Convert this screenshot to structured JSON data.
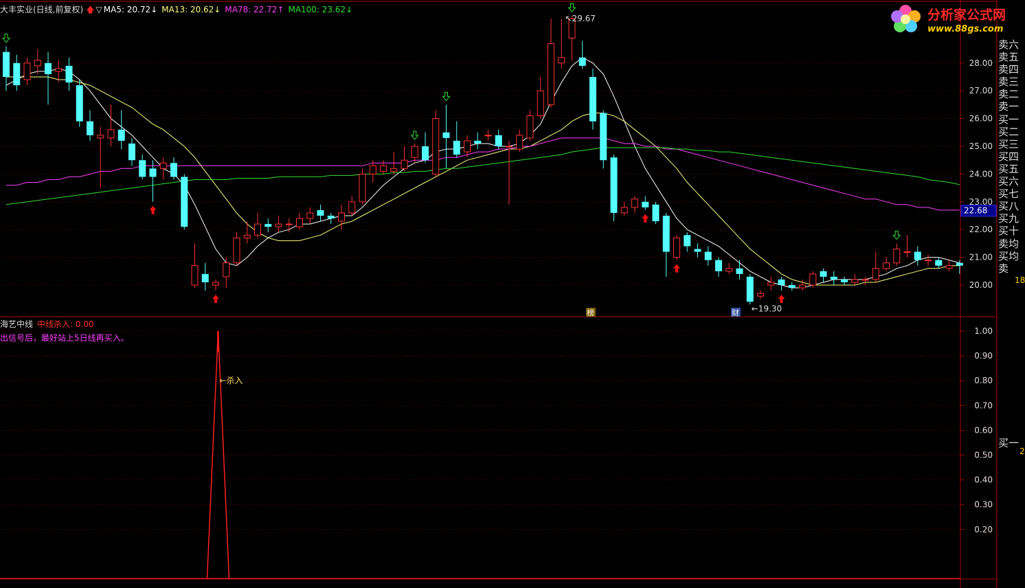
{
  "header": {
    "stock_title": "大丰实业(日线,前复权)",
    "arrow_glyph": "▽",
    "ma5": "MA5: 20.72",
    "ma13": "MA13: 20.62",
    "ma78": "MA78: 22.72",
    "ma100": "MA100: 23.62",
    "down_arrow": "↓",
    "up_arrow": "↑"
  },
  "logo": {
    "name": "分析家公式网",
    "url_text": "www.88gs.com"
  },
  "indicator": {
    "name": "海艺中线",
    "value_label": "中线杀入: 0.00",
    "note": "出信号后，最好站上5日线再买入。",
    "signal_label": "←杀入"
  },
  "order_book": [
    "卖六",
    "卖五",
    "卖四",
    "卖三",
    "卖二",
    "卖一",
    "买一",
    "买二",
    "买三",
    "买四",
    "买五",
    "买六",
    "买七",
    "买八",
    "买九",
    "买十",
    "卖均",
    "买均",
    "卖"
  ],
  "order_book_bottom": "买一",
  "side_numbers": {
    "upper": "18",
    "lower": "2"
  },
  "price_box": "22.68",
  "annotations": {
    "high": "29.67",
    "low": "←19.30",
    "bang": "榜",
    "cai": "财"
  },
  "colors": {
    "up": "#ff3232",
    "down": "#54ffff",
    "ma5": "#ffffff",
    "ma13": "#ffff80",
    "ma78": "#ff40ff",
    "ma100": "#30e030",
    "axis": "#b00000",
    "signal": "#ff2020"
  },
  "chart_data": [
    {
      "type": "candlestick",
      "title": "大丰实业(日线,前复权)",
      "ylim": [
        19.2,
        29.8
      ],
      "yticks": [
        20.0,
        21.0,
        22.0,
        23.0,
        24.0,
        25.0,
        26.0,
        27.0,
        28.0
      ],
      "candles": [
        {
          "o": 28.4,
          "c": 27.5,
          "h": 28.6,
          "l": 27.0
        },
        {
          "o": 28.0,
          "c": 27.2,
          "h": 28.3,
          "l": 27.0
        },
        {
          "o": 27.4,
          "c": 28.0,
          "h": 28.2,
          "l": 27.2
        },
        {
          "o": 27.9,
          "c": 28.1,
          "h": 28.5,
          "l": 27.6
        },
        {
          "o": 28.0,
          "c": 27.6,
          "h": 28.4,
          "l": 26.5
        },
        {
          "o": 27.7,
          "c": 27.8,
          "h": 28.1,
          "l": 27.3
        },
        {
          "o": 27.9,
          "c": 27.3,
          "h": 28.2,
          "l": 27.0
        },
        {
          "o": 27.2,
          "c": 25.9,
          "h": 27.4,
          "l": 25.7
        },
        {
          "o": 25.9,
          "c": 25.4,
          "h": 26.3,
          "l": 25.2
        },
        {
          "o": 25.3,
          "c": 25.4,
          "h": 25.7,
          "l": 23.5
        },
        {
          "o": 25.3,
          "c": 25.6,
          "h": 26.5,
          "l": 25.0
        },
        {
          "o": 25.6,
          "c": 25.2,
          "h": 26.3,
          "l": 24.9
        },
        {
          "o": 25.1,
          "c": 24.5,
          "h": 25.3,
          "l": 24.3
        },
        {
          "o": 24.5,
          "c": 23.9,
          "h": 24.7,
          "l": 23.8
        },
        {
          "o": 24.2,
          "c": 23.9,
          "h": 24.5,
          "l": 23.0
        },
        {
          "o": 24.2,
          "c": 24.4,
          "h": 24.6,
          "l": 23.8
        },
        {
          "o": 24.4,
          "c": 23.9,
          "h": 24.6,
          "l": 23.8
        },
        {
          "o": 23.9,
          "c": 22.1,
          "h": 24.0,
          "l": 22.0
        },
        {
          "o": 20.0,
          "c": 20.7,
          "h": 21.5,
          "l": 19.9
        },
        {
          "o": 20.4,
          "c": 20.1,
          "h": 20.8,
          "l": 19.8
        },
        {
          "o": 20.0,
          "c": 20.1,
          "h": 20.2,
          "l": 19.8
        },
        {
          "o": 20.3,
          "c": 20.8,
          "h": 21.0,
          "l": 19.9
        },
        {
          "o": 20.8,
          "c": 21.7,
          "h": 21.9,
          "l": 20.7
        },
        {
          "o": 21.7,
          "c": 21.8,
          "h": 22.3,
          "l": 21.5
        },
        {
          "o": 21.8,
          "c": 22.2,
          "h": 22.6,
          "l": 21.7
        },
        {
          "o": 22.2,
          "c": 22.1,
          "h": 22.4,
          "l": 21.9
        },
        {
          "o": 22.1,
          "c": 22.2,
          "h": 22.5,
          "l": 21.9
        },
        {
          "o": 22.2,
          "c": 22.2,
          "h": 22.4,
          "l": 21.9
        },
        {
          "o": 22.1,
          "c": 22.4,
          "h": 22.6,
          "l": 22.0
        },
        {
          "o": 22.4,
          "c": 22.6,
          "h": 22.8,
          "l": 22.2
        },
        {
          "o": 22.7,
          "c": 22.5,
          "h": 22.9,
          "l": 22.3
        },
        {
          "o": 22.5,
          "c": 22.4,
          "h": 22.6,
          "l": 22.2
        },
        {
          "o": 22.3,
          "c": 22.6,
          "h": 22.9,
          "l": 22.0
        },
        {
          "o": 22.6,
          "c": 23.0,
          "h": 23.2,
          "l": 22.5
        },
        {
          "o": 23.0,
          "c": 24.0,
          "h": 24.2,
          "l": 22.9
        },
        {
          "o": 24.0,
          "c": 24.3,
          "h": 24.5,
          "l": 23.7
        },
        {
          "o": 24.1,
          "c": 24.3,
          "h": 24.5,
          "l": 24.0
        },
        {
          "o": 24.1,
          "c": 24.2,
          "h": 24.8,
          "l": 24.0
        },
        {
          "o": 24.2,
          "c": 24.5,
          "h": 25.0,
          "l": 24.1
        },
        {
          "o": 24.6,
          "c": 25.0,
          "h": 25.1,
          "l": 24.4
        },
        {
          "o": 25.0,
          "c": 24.5,
          "h": 25.5,
          "l": 24.4
        },
        {
          "o": 24.0,
          "c": 26.0,
          "h": 26.3,
          "l": 23.9
        },
        {
          "o": 25.5,
          "c": 25.3,
          "h": 26.5,
          "l": 24.2
        },
        {
          "o": 25.2,
          "c": 24.7,
          "h": 25.9,
          "l": 24.6
        },
        {
          "o": 24.8,
          "c": 25.2,
          "h": 25.4,
          "l": 24.6
        },
        {
          "o": 25.2,
          "c": 25.1,
          "h": 25.5,
          "l": 24.9
        },
        {
          "o": 25.4,
          "c": 25.4,
          "h": 25.6,
          "l": 25.2
        },
        {
          "o": 25.4,
          "c": 25.0,
          "h": 25.6,
          "l": 24.9
        },
        {
          "o": 25.0,
          "c": 25.0,
          "h": 25.2,
          "l": 22.9
        },
        {
          "o": 24.9,
          "c": 25.4,
          "h": 25.6,
          "l": 24.8
        },
        {
          "o": 25.3,
          "c": 26.1,
          "h": 26.3,
          "l": 25.2
        },
        {
          "o": 26.1,
          "c": 27.0,
          "h": 27.5,
          "l": 26.0
        },
        {
          "o": 26.5,
          "c": 28.7,
          "h": 29.6,
          "l": 26.4
        },
        {
          "o": 28.0,
          "c": 28.2,
          "h": 29.6,
          "l": 27.8
        },
        {
          "o": 28.9,
          "c": 29.6,
          "h": 29.7,
          "l": 28.1
        },
        {
          "o": 28.2,
          "c": 27.9,
          "h": 28.8,
          "l": 27.8
        },
        {
          "o": 27.5,
          "c": 25.9,
          "h": 27.8,
          "l": 25.6
        },
        {
          "o": 26.2,
          "c": 24.5,
          "h": 26.3,
          "l": 24.2
        },
        {
          "o": 24.6,
          "c": 22.6,
          "h": 24.7,
          "l": 22.3
        },
        {
          "o": 22.6,
          "c": 22.8,
          "h": 23.0,
          "l": 22.5
        },
        {
          "o": 22.8,
          "c": 23.1,
          "h": 23.2,
          "l": 22.6
        },
        {
          "o": 23.0,
          "c": 22.8,
          "h": 23.2,
          "l": 22.7
        },
        {
          "o": 22.9,
          "c": 22.3,
          "h": 23.0,
          "l": 22.2
        },
        {
          "o": 22.5,
          "c": 21.2,
          "h": 22.6,
          "l": 20.3
        },
        {
          "o": 21.0,
          "c": 21.7,
          "h": 21.8,
          "l": 20.9
        },
        {
          "o": 21.8,
          "c": 21.4,
          "h": 21.9,
          "l": 21.2
        },
        {
          "o": 21.3,
          "c": 21.2,
          "h": 21.5,
          "l": 21.0
        },
        {
          "o": 21.2,
          "c": 20.9,
          "h": 21.4,
          "l": 20.7
        },
        {
          "o": 20.9,
          "c": 20.5,
          "h": 21.0,
          "l": 20.3
        },
        {
          "o": 20.5,
          "c": 20.6,
          "h": 20.8,
          "l": 20.4
        },
        {
          "o": 20.6,
          "c": 20.4,
          "h": 20.9,
          "l": 20.2
        },
        {
          "o": 20.3,
          "c": 19.4,
          "h": 20.4,
          "l": 19.3
        },
        {
          "o": 19.6,
          "c": 19.7,
          "h": 19.8,
          "l": 19.5
        },
        {
          "o": 20.0,
          "c": 20.1,
          "h": 20.3,
          "l": 19.8
        },
        {
          "o": 20.2,
          "c": 20.0,
          "h": 20.3,
          "l": 19.8
        },
        {
          "o": 20.0,
          "c": 19.9,
          "h": 20.1,
          "l": 19.8
        },
        {
          "o": 19.9,
          "c": 20.0,
          "h": 20.2,
          "l": 19.8
        },
        {
          "o": 20.0,
          "c": 20.4,
          "h": 20.5,
          "l": 19.9
        },
        {
          "o": 20.5,
          "c": 20.3,
          "h": 20.6,
          "l": 20.1
        },
        {
          "o": 20.3,
          "c": 20.2,
          "h": 20.5,
          "l": 20.0
        },
        {
          "o": 20.2,
          "c": 20.1,
          "h": 20.3,
          "l": 20.0
        },
        {
          "o": 20.1,
          "c": 20.2,
          "h": 20.4,
          "l": 20.0
        },
        {
          "o": 20.2,
          "c": 20.2,
          "h": 20.3,
          "l": 20.0
        },
        {
          "o": 20.2,
          "c": 20.6,
          "h": 21.2,
          "l": 20.1
        },
        {
          "o": 20.6,
          "c": 20.8,
          "h": 21.0,
          "l": 20.5
        },
        {
          "o": 20.8,
          "c": 21.3,
          "h": 21.5,
          "l": 20.7
        },
        {
          "o": 21.2,
          "c": 21.2,
          "h": 21.8,
          "l": 21.0
        },
        {
          "o": 21.2,
          "c": 20.9,
          "h": 21.4,
          "l": 20.7
        },
        {
          "o": 20.9,
          "c": 20.9,
          "h": 21.1,
          "l": 20.7
        },
        {
          "o": 20.9,
          "c": 20.7,
          "h": 21.0,
          "l": 20.6
        },
        {
          "o": 20.6,
          "c": 20.7,
          "h": 20.9,
          "l": 20.5
        },
        {
          "o": 20.8,
          "c": 20.7,
          "h": 20.9,
          "l": 20.4
        }
      ],
      "series": [
        {
          "name": "MA5",
          "values": [
            27.2,
            27.4,
            27.6,
            27.7,
            27.7,
            27.8,
            27.7,
            27.4,
            27.0,
            26.5,
            26.0,
            25.7,
            25.4,
            25.0,
            24.6,
            24.2,
            24.0,
            23.6,
            22.9,
            22.1,
            21.3,
            20.8,
            20.7,
            21.0,
            21.4,
            21.7,
            21.9,
            22.0,
            22.2,
            22.2,
            22.3,
            22.4,
            22.5,
            22.5,
            22.8,
            23.2,
            23.6,
            23.9,
            24.2,
            24.4,
            24.5,
            24.8,
            24.9,
            24.9,
            25.0,
            25.1,
            25.1,
            25.0,
            25.0,
            25.1,
            25.4,
            25.8,
            26.6,
            27.3,
            27.9,
            28.2,
            28.0,
            27.6,
            26.8,
            25.9,
            25.0,
            24.2,
            23.6,
            23.0,
            22.4,
            22.0,
            21.8,
            21.6,
            21.4,
            21.1,
            20.8,
            20.5,
            20.3,
            20.1,
            20.0,
            19.9,
            19.9,
            20.0,
            20.1,
            20.2,
            20.2,
            20.2,
            20.2,
            20.3,
            20.4,
            20.6,
            20.7,
            20.9,
            21.0,
            21.0,
            20.9,
            20.8
          ]
        },
        {
          "name": "MA13",
          "values": [
            27.5,
            27.5,
            27.5,
            27.5,
            27.5,
            27.4,
            27.4,
            27.3,
            27.2,
            27.0,
            26.8,
            26.6,
            26.4,
            26.1,
            25.8,
            25.6,
            25.3,
            25.0,
            24.6,
            24.1,
            23.6,
            23.1,
            22.6,
            22.2,
            21.9,
            21.7,
            21.6,
            21.6,
            21.6,
            21.7,
            21.8,
            22.0,
            22.2,
            22.3,
            22.5,
            22.7,
            22.9,
            23.1,
            23.3,
            23.5,
            23.7,
            23.9,
            24.1,
            24.3,
            24.5,
            24.6,
            24.7,
            24.8,
            24.9,
            24.9,
            25.0,
            25.2,
            25.4,
            25.6,
            25.9,
            26.1,
            26.2,
            26.2,
            26.1,
            25.9,
            25.6,
            25.3,
            25.0,
            24.6,
            24.2,
            23.7,
            23.3,
            22.9,
            22.5,
            22.1,
            21.7,
            21.3,
            21.0,
            20.7,
            20.4,
            20.2,
            20.1,
            20.0,
            20.0,
            20.0,
            20.0,
            20.0,
            20.1,
            20.1,
            20.2,
            20.3,
            20.4,
            20.5,
            20.6,
            20.6,
            20.7,
            20.7
          ]
        },
        {
          "name": "MA78",
          "values": [
            23.6,
            23.6,
            23.7,
            23.7,
            23.8,
            23.8,
            23.9,
            23.9,
            24.0,
            24.1,
            24.1,
            24.2,
            24.2,
            24.3,
            24.3,
            24.3,
            24.3,
            24.3,
            24.3,
            24.3,
            24.3,
            24.3,
            24.3,
            24.3,
            24.3,
            24.3,
            24.3,
            24.3,
            24.3,
            24.3,
            24.3,
            24.3,
            24.3,
            24.3,
            24.3,
            24.4,
            24.4,
            24.4,
            24.4,
            24.5,
            24.5,
            24.5,
            24.6,
            24.6,
            24.7,
            24.8,
            24.8,
            24.9,
            24.9,
            25.0,
            25.0,
            25.1,
            25.2,
            25.3,
            25.3,
            25.3,
            25.3,
            25.3,
            25.2,
            25.1,
            25.1,
            25.0,
            25.0,
            24.9,
            24.9,
            24.8,
            24.7,
            24.6,
            24.5,
            24.4,
            24.3,
            24.2,
            24.1,
            24.0,
            23.9,
            23.8,
            23.7,
            23.6,
            23.5,
            23.4,
            23.3,
            23.2,
            23.1,
            23.1,
            23.0,
            22.9,
            22.9,
            22.8,
            22.8,
            22.7,
            22.7,
            22.7
          ]
        },
        {
          "name": "MA100",
          "values": [
            22.9,
            22.95,
            23.0,
            23.05,
            23.1,
            23.15,
            23.2,
            23.25,
            23.3,
            23.35,
            23.4,
            23.45,
            23.5,
            23.55,
            23.6,
            23.65,
            23.7,
            23.75,
            23.8,
            23.8,
            23.8,
            23.8,
            23.85,
            23.85,
            23.85,
            23.85,
            23.9,
            23.9,
            23.9,
            23.9,
            23.9,
            23.95,
            23.95,
            23.95,
            24.0,
            24.0,
            24.0,
            24.05,
            24.05,
            24.1,
            24.1,
            24.15,
            24.2,
            24.2,
            24.25,
            24.3,
            24.35,
            24.4,
            24.45,
            24.5,
            24.55,
            24.6,
            24.65,
            24.7,
            24.8,
            24.85,
            24.9,
            24.95,
            24.95,
            24.95,
            24.95,
            24.95,
            24.95,
            24.95,
            24.9,
            24.9,
            24.85,
            24.85,
            24.8,
            24.8,
            24.75,
            24.7,
            24.65,
            24.6,
            24.55,
            24.5,
            24.45,
            24.4,
            24.35,
            24.3,
            24.25,
            24.2,
            24.15,
            24.1,
            24.05,
            24.0,
            23.95,
            23.9,
            23.8,
            23.75,
            23.7,
            23.62
          ]
        }
      ],
      "up_markers": [
        14,
        20,
        61,
        64,
        74
      ],
      "down_markers": [
        0,
        39,
        42,
        54,
        85
      ]
    },
    {
      "type": "line",
      "title": "海艺中线",
      "ylim": [
        0,
        1.1
      ],
      "yticks": [
        0.2,
        0.3,
        0.4,
        0.5,
        0.6,
        0.7,
        0.8,
        0.9,
        1.0
      ],
      "series": [
        {
          "name": "中线杀入",
          "peak_index": 20,
          "peak_value": 1.0
        }
      ]
    }
  ]
}
